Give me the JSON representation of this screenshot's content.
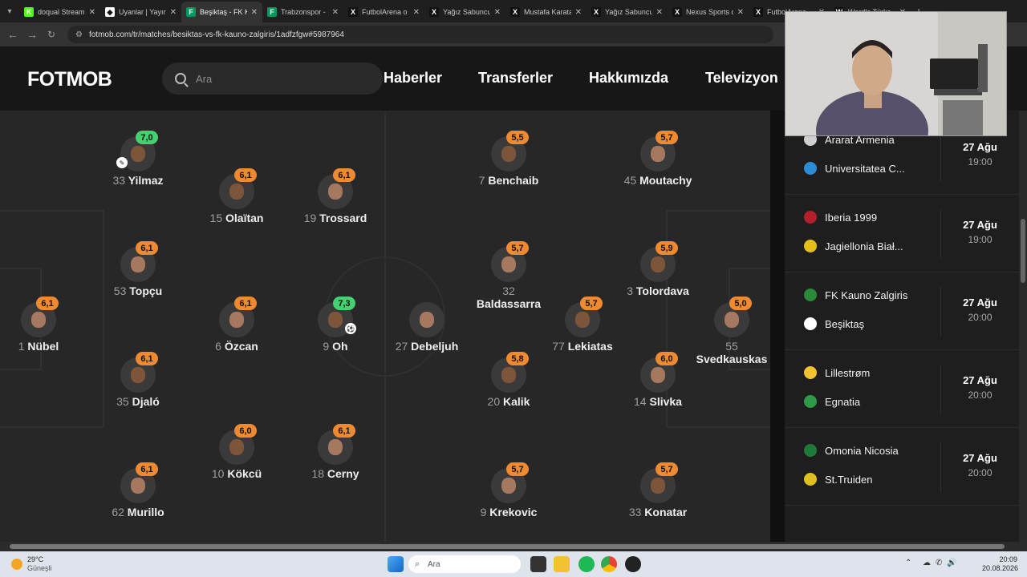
{
  "browser": {
    "tabs": [
      {
        "title": "doqual Stream",
        "fav": "K",
        "color": "#53fc18"
      },
      {
        "title": "Uyanlar | Yayın",
        "fav": "◆",
        "color": "#ffffff"
      },
      {
        "title": "Beşiktaş - FK Ka",
        "fav": "F",
        "color": "#00985f"
      },
      {
        "title": "Trabzonspor - ",
        "fav": "F",
        "color": "#00985f"
      },
      {
        "title": "FutbolArena o",
        "fav": "X",
        "color": "#111111"
      },
      {
        "title": "Yağız Sabuncu",
        "fav": "X",
        "color": "#111111"
      },
      {
        "title": "Mustafa Karata",
        "fav": "X",
        "color": "#111111"
      },
      {
        "title": "Yağız Sabuncu",
        "fav": "X",
        "color": "#111111"
      },
      {
        "title": "Nexus Sports o",
        "fav": "X",
        "color": "#111111"
      },
      {
        "title": "FutbolArena",
        "fav": "X",
        "color": "#111111"
      },
      {
        "title": "Wordle Türkç",
        "fav": "W",
        "color": "#111111"
      }
    ],
    "url": "fotmob.com/tr/matches/besiktas-vs-fk-kauno-zalgiris/1adfzfgw#5987964"
  },
  "header": {
    "logo": "FOTMOB",
    "search_placeholder": "Ara",
    "nav": [
      "Haberler",
      "Transferler",
      "Hakkımızda",
      "Televizyon"
    ]
  },
  "colors": {
    "green": "#44d16f",
    "orange": "#f08a31"
  },
  "lineup": {
    "home": [
      {
        "num": "1",
        "name": "Nübel",
        "rating": "6,1",
        "rc": "orange"
      },
      {
        "num": "33",
        "name": "Yilmaz",
        "rating": "7,0",
        "rc": "green"
      },
      {
        "num": "53",
        "name": "Topçu",
        "rating": "6,1",
        "rc": "orange"
      },
      {
        "num": "35",
        "name": "Djaló",
        "rating": "6,1",
        "rc": "orange"
      },
      {
        "num": "62",
        "name": "Murillo",
        "rating": "6,1",
        "rc": "orange"
      },
      {
        "num": "15",
        "name": "Olaïtan",
        "rating": "6,1",
        "rc": "orange"
      },
      {
        "num": "6",
        "name": "Özcan",
        "rating": "6,1",
        "rc": "orange"
      },
      {
        "num": "10",
        "name": "Kökcü",
        "rating": "6,0",
        "rc": "orange"
      },
      {
        "num": "19",
        "name": "Trossard",
        "rating": "6,1",
        "rc": "orange"
      },
      {
        "num": "9",
        "name": "Oh",
        "rating": "7,3",
        "rc": "green"
      },
      {
        "num": "18",
        "name": "Cerny",
        "rating": "6,1",
        "rc": "orange"
      }
    ],
    "away": [
      {
        "num": "27",
        "name": "Debeljuh",
        "rating": ""
      },
      {
        "num": "7",
        "name": "Benchaib",
        "rating": "5,5",
        "rc": "orange"
      },
      {
        "num": "32",
        "name": "Baldassarra",
        "rating": "5,7",
        "rc": "orange"
      },
      {
        "num": "20",
        "name": "Kalik",
        "rating": "5,8",
        "rc": "orange"
      },
      {
        "num": "9",
        "name": "Krekovic",
        "rating": "5,7",
        "rc": "orange"
      },
      {
        "num": "77",
        "name": "Lekiatas",
        "rating": "5,7",
        "rc": "orange"
      },
      {
        "num": "45",
        "name": "Moutachy",
        "rating": "5,7",
        "rc": "orange"
      },
      {
        "num": "3",
        "name": "Tolordava",
        "rating": "5,9",
        "rc": "orange"
      },
      {
        "num": "14",
        "name": "Slivka",
        "rating": "6,0",
        "rc": "orange"
      },
      {
        "num": "33",
        "name": "Konatar",
        "rating": "5,7",
        "rc": "orange"
      },
      {
        "num": "55",
        "name": "Svedkauskas",
        "rating": "5,0",
        "rc": "orange"
      }
    ]
  },
  "matches": [
    {
      "home": "Ararat Armenia",
      "away": "Universitatea C...",
      "date": "27 Ağu",
      "time": "19:00"
    },
    {
      "home": "Iberia 1999",
      "away": "Jagiellonia Biał...",
      "date": "27 Ağu",
      "time": "19:00"
    },
    {
      "home": "FK Kauno Zalgiris",
      "away": "Beşiktaş",
      "date": "27 Ağu",
      "time": "20:00"
    },
    {
      "home": "Lillestrøm",
      "away": "Egnatia",
      "date": "27 Ağu",
      "time": "20:00"
    },
    {
      "home": "Omonia Nicosia",
      "away": "St.Truiden",
      "date": "27 Ağu",
      "time": "20:00"
    }
  ],
  "taskbar": {
    "weather_temp": "29°C",
    "weather_desc": "Güneşli",
    "search": "Ara",
    "time": "20:09",
    "date": "20.08.2026"
  }
}
